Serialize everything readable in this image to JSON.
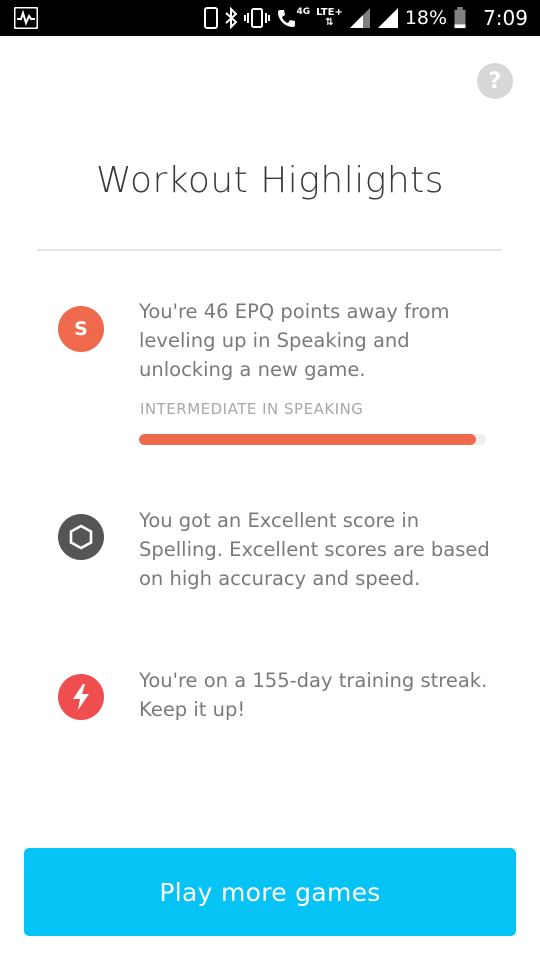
{
  "status_bar": {
    "network": "4G",
    "lte": "LTE+",
    "battery_percent": "18%",
    "time": "7:09",
    "icons": [
      "activity-icon",
      "phone-icon",
      "bluetooth-icon",
      "vibrate-icon",
      "call-icon",
      "signal-icon",
      "signal-icon",
      "battery-icon"
    ]
  },
  "help": {
    "label": "?"
  },
  "title": "Workout Highlights",
  "highlights": [
    {
      "icon": "speaking-badge-icon",
      "icon_letter": "S",
      "icon_color": "#ef6a4c",
      "text": "You're 46 EPQ points away from leveling up in Speaking and unlocking a new game.",
      "level_label": "INTERMEDIATE IN SPEAKING",
      "progress": 0.97
    },
    {
      "icon": "hexagon-icon",
      "icon_color": "#555555",
      "text": "You got an Excellent score in Spelling. Excellent scores are based on high accuracy and speed."
    },
    {
      "icon": "lightning-icon",
      "icon_color": "#f04e4e",
      "text": "You're on a 155-day training streak. Keep it up!"
    }
  ],
  "cta": {
    "label": "Play more games",
    "color": "#06c3f5"
  }
}
